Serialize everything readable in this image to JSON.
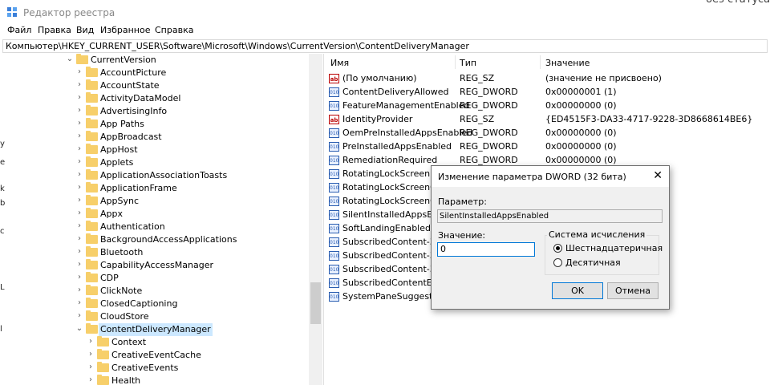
{
  "window": {
    "title": "Редактор реестра",
    "bg_peek": "без статуса"
  },
  "menu": [
    "Файл",
    "Правка",
    "Вид",
    "Избранное",
    "Справка"
  ],
  "address": "Компьютер\\HKEY_CURRENT_USER\\Software\\Microsoft\\Windows\\CurrentVersion\\ContentDeliveryManager",
  "left_edge": [
    "у",
    "e",
    "k",
    "b",
    "c",
    "L",
    "l"
  ],
  "tree": [
    {
      "label": "CurrentVersion",
      "expanded": true
    },
    {
      "label": "AccountPicture"
    },
    {
      "label": "AccountState"
    },
    {
      "label": "ActivityDataModel"
    },
    {
      "label": "AdvertisingInfo"
    },
    {
      "label": "App Paths"
    },
    {
      "label": "AppBroadcast"
    },
    {
      "label": "AppHost"
    },
    {
      "label": "Applets"
    },
    {
      "label": "ApplicationAssociationToasts"
    },
    {
      "label": "ApplicationFrame"
    },
    {
      "label": "AppSync"
    },
    {
      "label": "Appx"
    },
    {
      "label": "Authentication"
    },
    {
      "label": "BackgroundAccessApplications"
    },
    {
      "label": "Bluetooth"
    },
    {
      "label": "CapabilityAccessManager"
    },
    {
      "label": "CDP"
    },
    {
      "label": "ClickNote"
    },
    {
      "label": "ClosedCaptioning"
    },
    {
      "label": "CloudStore"
    },
    {
      "label": "ContentDeliveryManager",
      "expanded": true,
      "selected": true
    },
    {
      "label": "Context"
    },
    {
      "label": "CreativeEventCache"
    },
    {
      "label": "CreativeEvents"
    },
    {
      "label": "Health"
    }
  ],
  "columns": {
    "name": "Имя",
    "type": "Тип",
    "data": "Значение"
  },
  "values": [
    {
      "name": "(По умолчанию)",
      "type": "REG_SZ",
      "data": "(значение не присвоено)",
      "icon": "string-value-icon"
    },
    {
      "name": "ContentDeliveryAllowed",
      "type": "REG_DWORD",
      "data": "0x00000001 (1)",
      "icon": "dword-value-icon"
    },
    {
      "name": "FeatureManagementEnabled",
      "type": "REG_DWORD",
      "data": "0x00000000 (0)",
      "icon": "dword-value-icon"
    },
    {
      "name": "IdentityProvider",
      "type": "REG_SZ",
      "data": "{ED4515F3-DA33-4717-9228-3D8668614BE6}",
      "icon": "string-value-icon"
    },
    {
      "name": "OemPreInstalledAppsEnabled",
      "type": "REG_DWORD",
      "data": "0x00000000 (0)",
      "icon": "dword-value-icon"
    },
    {
      "name": "PreInstalledAppsEnabled",
      "type": "REG_DWORD",
      "data": "0x00000000 (0)",
      "icon": "dword-value-icon"
    },
    {
      "name": "RemediationRequired",
      "type": "REG_DWORD",
      "data": "0x00000000 (0)",
      "icon": "dword-value-icon"
    },
    {
      "name": "RotatingLockScreenEna",
      "type": "",
      "data": "",
      "icon": "dword-value-icon"
    },
    {
      "name": "RotatingLockScreenOve",
      "type": "",
      "data": "",
      "icon": "dword-value-icon"
    },
    {
      "name": "RotatingLockScreenOve",
      "type": "",
      "data": "",
      "icon": "dword-value-icon"
    },
    {
      "name": "SilentInstalledAppsEnal",
      "type": "",
      "data": "",
      "icon": "dword-value-icon"
    },
    {
      "name": "SoftLandingEnabled",
      "type": "",
      "data": "",
      "icon": "dword-value-icon"
    },
    {
      "name": "SubscribedContent-338",
      "type": "",
      "data": "",
      "icon": "dword-value-icon"
    },
    {
      "name": "SubscribedContent-338",
      "type": "",
      "data": "",
      "icon": "dword-value-icon"
    },
    {
      "name": "SubscribedContent-338",
      "type": "",
      "data": "",
      "icon": "dword-value-icon"
    },
    {
      "name": "SubscribedContentEnab",
      "type": "",
      "data": "",
      "icon": "dword-value-icon"
    },
    {
      "name": "SystemPaneSuggestion",
      "type": "",
      "data": "",
      "icon": "dword-value-icon"
    }
  ],
  "dialog": {
    "title": "Изменение параметра DWORD (32 бита)",
    "close": "✕",
    "param_label": "Параметр:",
    "param_value": "SilentInstalledAppsEnabled",
    "value_label": "Значение:",
    "value": "0",
    "base_legend": "Система исчисления",
    "radio_hex": "Шестнадцатеричная",
    "radio_dec": "Десятичная",
    "base_selected": "hex",
    "ok": "OK",
    "cancel": "Отмена"
  },
  "colors": {
    "selection": "#cce8ff",
    "folder": "#f7cf6a",
    "accent": "#0078d7"
  }
}
